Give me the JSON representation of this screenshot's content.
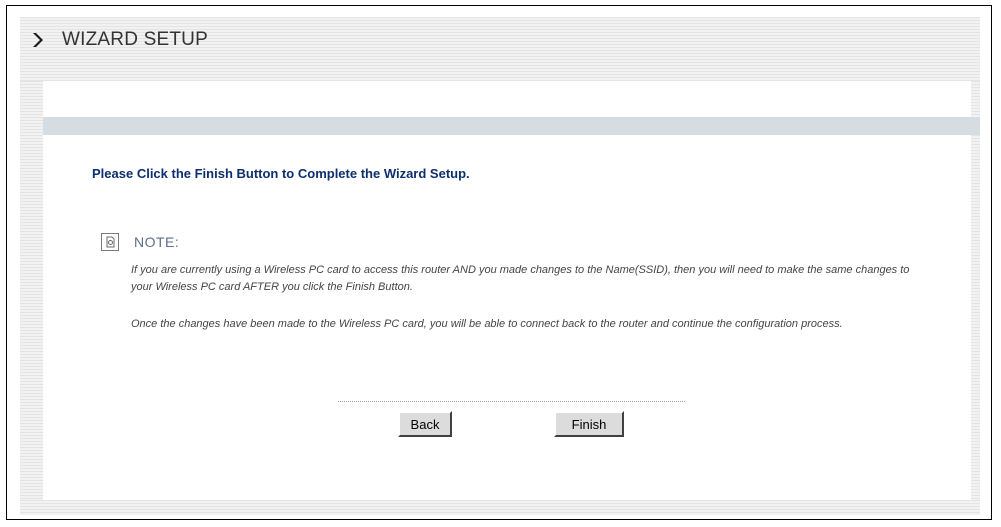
{
  "header": {
    "title": "WIZARD SETUP",
    "arrow_icon": "chevron-right-icon"
  },
  "main": {
    "instruction": "Please Click the Finish Button to Complete the Wizard Setup.",
    "note": {
      "icon": "note-icon",
      "label": "NOTE:",
      "paragraphs": [
        "If you are currently using a Wireless PC card to access this router AND you made changes to the Name(SSID), then you will need to make the same changes to your Wireless PC card AFTER you click the Finish Button.",
        "Once the changes have been made to the Wireless PC card, you will be able to connect back to the router and continue the configuration process."
      ]
    }
  },
  "buttons": {
    "back_label": "Back",
    "finish_label": "Finish"
  },
  "colors": {
    "instruction_text": "#0d2f6e",
    "note_label": "#5e6e8a",
    "separator_bar": "#d5dde3"
  }
}
